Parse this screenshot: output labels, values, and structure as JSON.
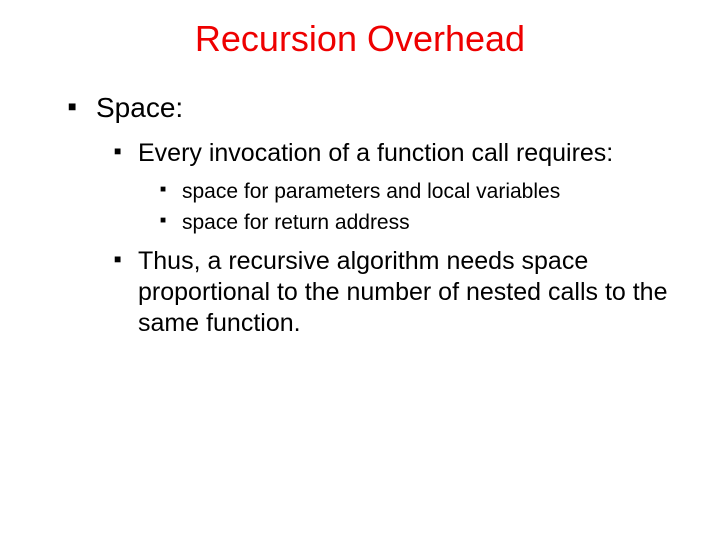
{
  "title": "Recursion Overhead",
  "bullets": {
    "l1": "Space:",
    "l2a": "Every invocation of a function call requires:",
    "l3a": "space for parameters and local variables",
    "l3b": "space for return address",
    "l2b": "Thus, a recursive algorithm needs space proportional to the number of nested calls to the same function."
  }
}
